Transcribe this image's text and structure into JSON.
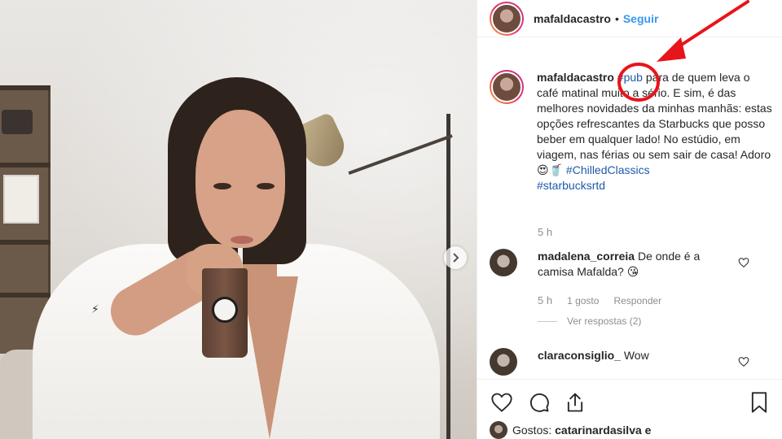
{
  "post": {
    "username": "mafaldacastro",
    "follow_label": "Seguir",
    "caption_username": "mafaldacastro",
    "caption_tag_pub": "#pub",
    "caption_text": " para de quem leva o café matinal muito a sério. E sim, é das melhores novidades da minhas manhãs: estas opções refrescantes da Starbucks que posso beber em qualquer lado! No estúdio, em viagem, nas férias ou sem sair de casa! Adoro 😍🥤 ",
    "caption_tag_chilled": "#ChilledClassics",
    "caption_tag_starbucks": "#starbucksrtd",
    "caption_time": "5 h"
  },
  "comments": [
    {
      "username": "madalena_correia",
      "text": " De onde é a camisa Mafalda? 😘",
      "time": "5 h",
      "likes": "1 gosto",
      "reply_label": "Responder",
      "view_replies": "Ver respostas (2)"
    },
    {
      "username": "claraconsiglio_",
      "text": " Wow"
    }
  ],
  "likes_bar": {
    "label": "Gostos:",
    "first_user": "catarinardasilva e"
  },
  "icons": [
    "heart-icon",
    "comment-icon",
    "share-icon",
    "bookmark-icon",
    "chevron-right-icon"
  ],
  "colors": {
    "link": "#3897f0",
    "hashtag": "#1e5aa8",
    "annotation": "#e8141b"
  }
}
